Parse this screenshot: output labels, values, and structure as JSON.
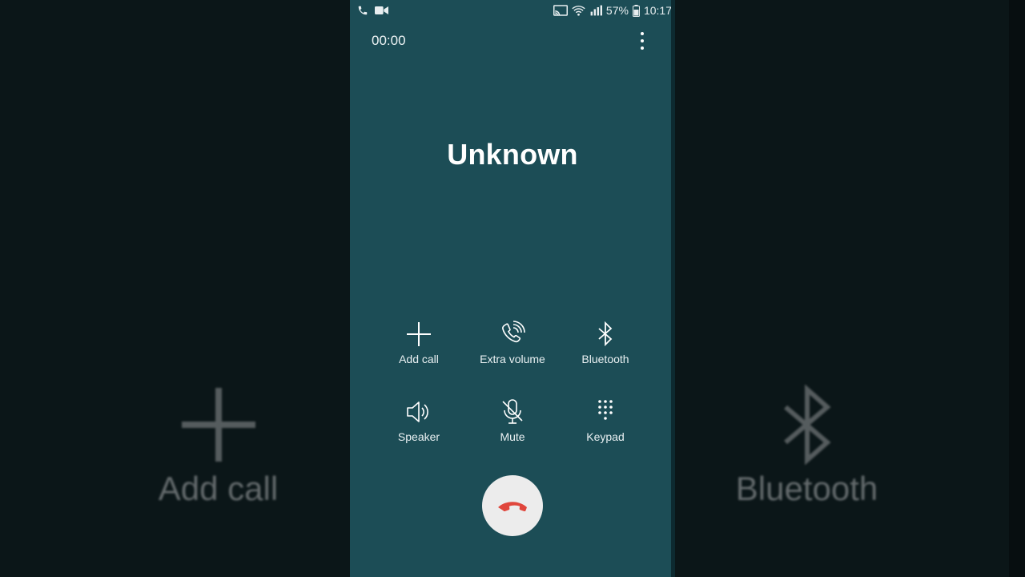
{
  "status_bar": {
    "battery_percent": "57%",
    "time": "10:17"
  },
  "call": {
    "timer": "00:00",
    "caller_name": "Unknown"
  },
  "controls": [
    {
      "label": "Add call",
      "icon": "plus-icon"
    },
    {
      "label": "Extra volume",
      "icon": "phone-volume-icon"
    },
    {
      "label": "Bluetooth",
      "icon": "bluetooth-icon"
    },
    {
      "label": "Speaker",
      "icon": "speaker-icon"
    },
    {
      "label": "Mute",
      "icon": "mic-mute-icon"
    },
    {
      "label": "Keypad",
      "icon": "keypad-icon"
    }
  ],
  "background": {
    "left_label": "Add call",
    "right_label": "Bluetooth"
  },
  "colors": {
    "panel": "#1c4d56",
    "end_call_button": "#ececec",
    "end_call_icon": "#e0463c"
  }
}
